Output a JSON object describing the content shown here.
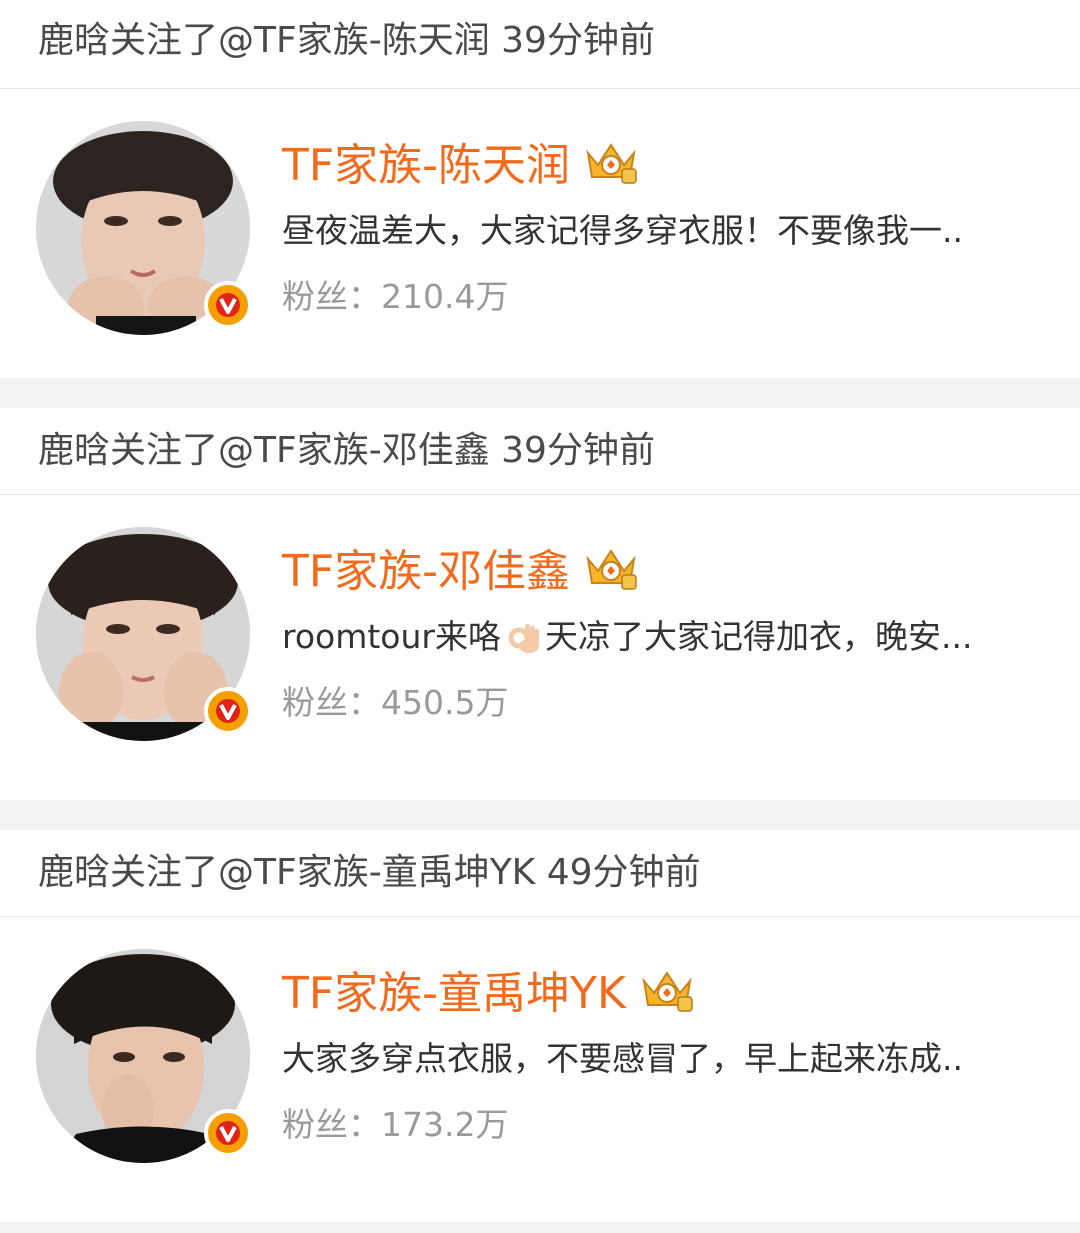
{
  "feed": [
    {
      "activity": "鹿晗关注了@TF家族-陈天润 39分钟前",
      "user": {
        "name": "TF家族-陈天润",
        "description": "昼夜温差大，大家记得多穿衣服！不要像我一..",
        "fans_label": "粉丝：",
        "fans_count": "210.4万",
        "avatar_icon": "profile-photo",
        "badge_icon": "crown-level-icon",
        "verified_icon": "verified-v-icon"
      }
    },
    {
      "activity": "鹿晗关注了@TF家族-邓佳鑫 39分钟前",
      "user": {
        "name": "TF家族-邓佳鑫",
        "description_pre": "roomtour来咯",
        "description_emoji": "ok-hand-emoji",
        "description_post": "天凉了大家记得加衣，晚安...",
        "fans_label": "粉丝：",
        "fans_count": "450.5万",
        "avatar_icon": "profile-photo",
        "badge_icon": "crown-level-icon",
        "verified_icon": "verified-v-icon"
      }
    },
    {
      "activity": "鹿晗关注了@TF家族-童禹坤YK 49分钟前",
      "user": {
        "name": "TF家族-童禹坤YK",
        "description": "大家多穿点衣服，不要感冒了，早上起来冻成..",
        "fans_label": "粉丝：",
        "fans_count": "173.2万",
        "avatar_icon": "profile-photo",
        "badge_icon": "crown-level-icon",
        "verified_icon": "verified-v-icon"
      }
    }
  ],
  "colors": {
    "name": "#f26a1b",
    "activity_text": "#4a4a4a",
    "fans_text": "#9a9a9a",
    "separator": "#f2f2f2",
    "verified_badge": "#f5a000"
  }
}
